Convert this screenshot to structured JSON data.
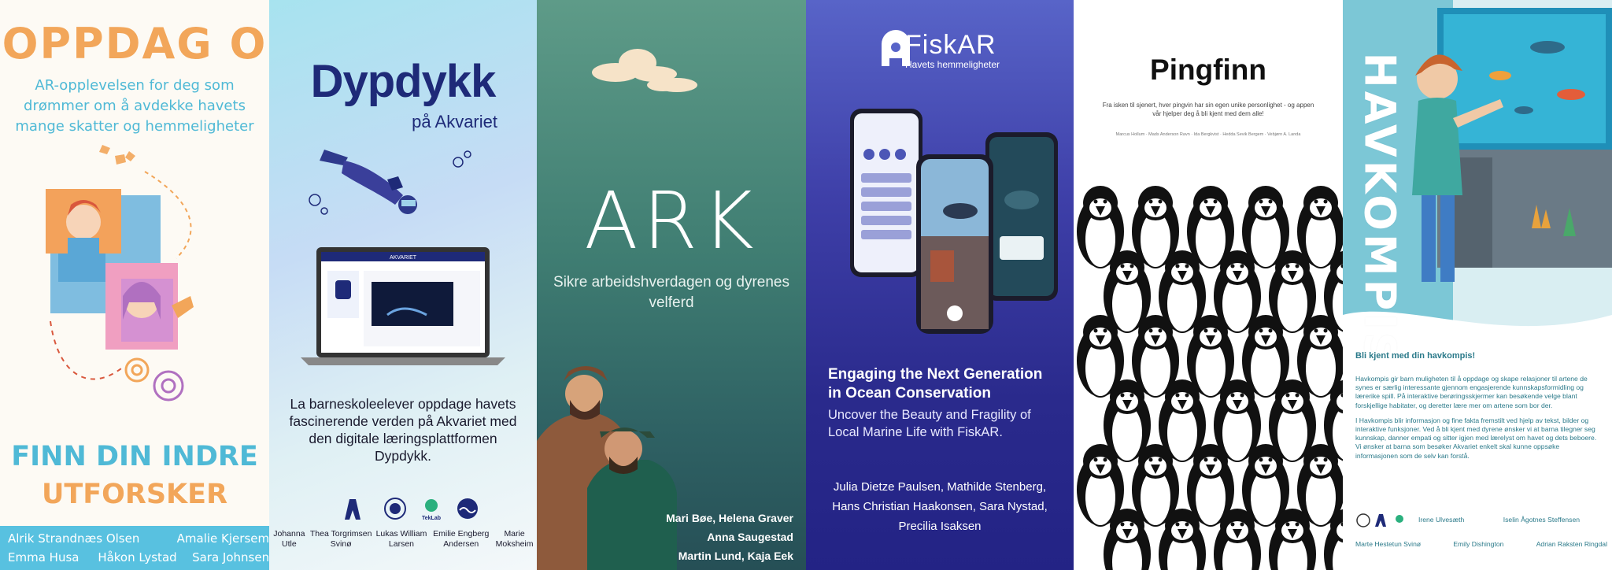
{
  "panels": {
    "oppdag": {
      "title": "OPPDAG O",
      "subtitle": "AR-opplevelsen for deg som drømmer om å avdekke havets mange skatter og hemmeligheter",
      "tagline_1": "FINN DIN INDRE",
      "tagline_2": "UTFORSKER",
      "names": [
        "Alrik Strandnæs Olsen",
        "Amalie Kjersem",
        "Emma Husa",
        "Håkon Lystad",
        "Sara Johnsen"
      ],
      "colors": {
        "orange": "#f2a65a",
        "blue": "#4fb9d6"
      }
    },
    "dypdykk": {
      "title": "Dypdykk",
      "subtitle": "på Akvariet",
      "description": "La barneskoleelever oppdage havets fascinerende verden på Akvariet med den digitale læringsplattformen Dypdykk.",
      "names": [
        "Johanna Utle",
        "Thea Torgrimsen Svinø",
        "Lukas William Larsen",
        "Emilie Engberg Andersen",
        "Marie Moksheim"
      ],
      "logo_text": "TekLab",
      "screen_text": "AKVARIET",
      "colors": {
        "navy": "#1e2a78"
      }
    },
    "ark": {
      "title": "ARK",
      "subtitle": "Sikre arbeidshverdagen og dyrenes velferd",
      "names": [
        "Mari Bøe, Helena Graver",
        "Anna Saugestad",
        "Martin Lund, Kaja Eek"
      ]
    },
    "fiskar": {
      "brand": "FiskAR",
      "brand_tagline": "Havets hemmeligheter",
      "heading": "Engaging the Next Generation in Ocean Conservation",
      "subheading": "Uncover the Beauty and Fragility of Local Marine Life with FiskAR.",
      "names": [
        "Julia Dietze Paulsen, Mathilde Stenberg,",
        "Hans Christian Haakonsen, Sara Nystad,",
        "Precilia Isaksen"
      ]
    },
    "pingfinn": {
      "title": "Pingfinn",
      "subtitle": "Fra isken til sjenert, hver pingvin har sin egen unike personlighet - og appen vår hjelper deg å bli kjent med dem alle!",
      "small_print": "Marcus Hollum · Mads Anderson Ravn · Ida Bergkvist · Hedda Sevik Bergem · Vebjørn A. Landa"
    },
    "havkompis": {
      "title": "HAVKOMPIS",
      "heading": "Bli kjent med din havkompis!",
      "paragraphs": [
        "Havkompis gir barn muligheten til å oppdage og skape relasjoner til artene de synes er særlig interessante gjennom engasjerende kunnskapsformidling og lærerike spill. På interaktive berøringsskjermer kan besøkende velge blant forskjellige habitater, og deretter lære mer om artene som bor der.",
        "I Havkompis blir informasjon og fine fakta fremstilt ved hjelp av tekst, bilder og interaktive funksjoner. Ved å bli kjent med dyrene ønsker vi at barna tilegner seg kunnskap, danner empati og sitter igjen med lærelyst om havet og dets beboere. Vi ønsker at barna som besøker Akvariet enkelt skal kunne oppsøke informasjonen som de selv kan forstå."
      ],
      "names_row1": [
        "Irene Ulvesæth",
        "Iselin Ågotnes Steffensen"
      ],
      "names_row2": [
        "Marte Hestetun Svinø",
        "Emily Dishington",
        "Adrian Raksten Ringdal"
      ],
      "colors": {
        "teal": "#2b7a8a"
      }
    }
  }
}
